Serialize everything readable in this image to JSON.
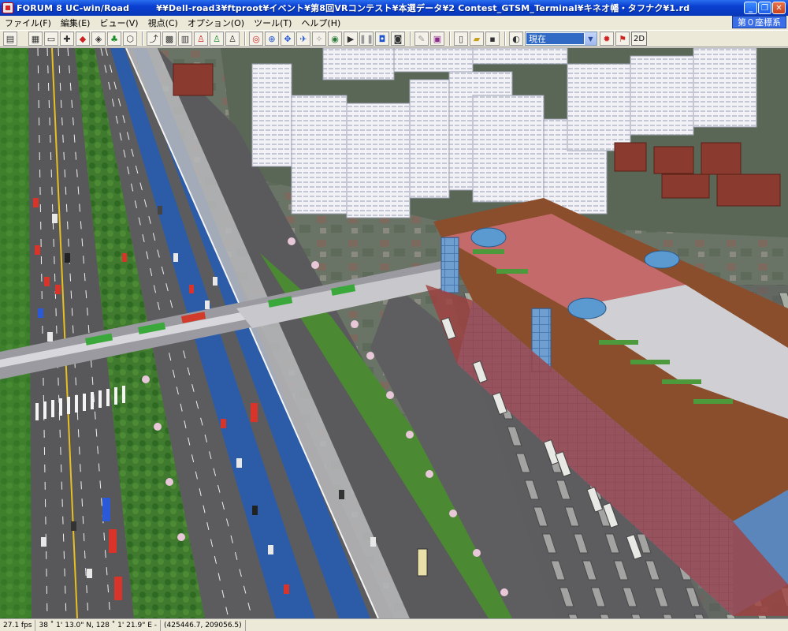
{
  "window": {
    "app_title": "FORUM 8   UC-win/Road",
    "file_path": "¥¥Dell-road3¥ftproot¥イベント¥第8回VRコンテスト¥本選データ¥2 Contest_GTSM_Terminal¥キネオ幡・タフナク¥1.rd"
  },
  "menu": {
    "items": [
      "ファイル(F)",
      "編集(E)",
      "ビュー(V)",
      "視点(C)",
      "オプション(O)",
      "ツール(T)",
      "ヘルプ(H)"
    ],
    "coord_system": "第０座標系"
  },
  "toolbar": {
    "time_select_value": "現在",
    "view_2d_label": "2D"
  },
  "status": {
    "fps": "27.1 fps",
    "latlon": "38 ˚  1' 13.0\" N, 128 ˚  1' 21.9\" E  -",
    "xy": "(425446.7, 209056.5)"
  },
  "colors": {
    "title_bar": "#0a3fd0",
    "road": "#5a5a5c",
    "bus_lane": "#2c5ca8",
    "glass_facade": "#6f9fd0",
    "roof": "#8a4e2c"
  }
}
